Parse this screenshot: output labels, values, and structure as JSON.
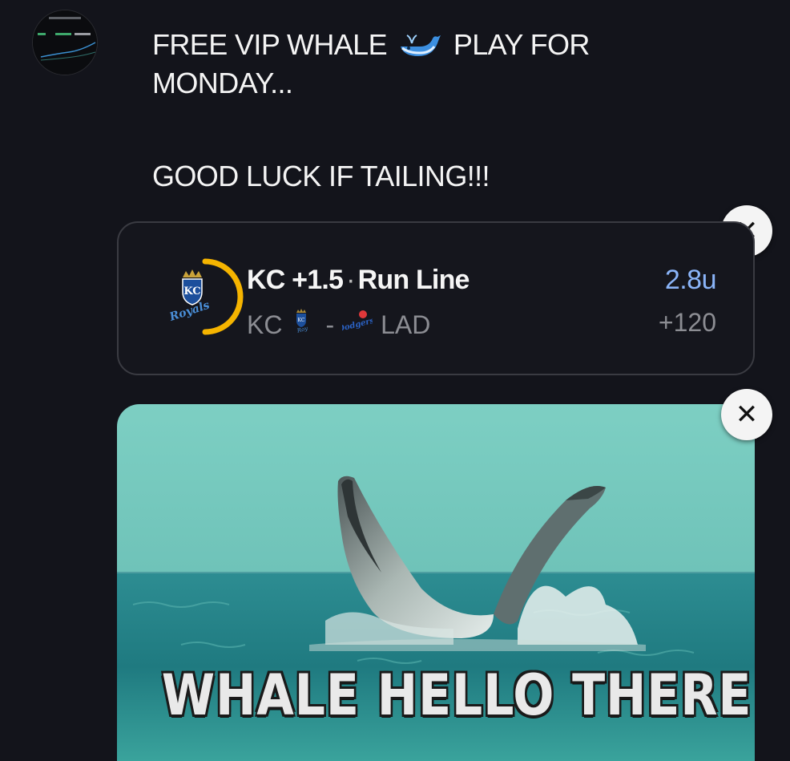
{
  "post": {
    "line1_a": "FREE VIP WHALE",
    "line1_b": "PLAY FOR",
    "line2": "MONDAY...",
    "line3": "GOOD LUCK IF TAILING!!!",
    "emoji": "whale-icon"
  },
  "bet": {
    "team": "KC",
    "line": "+1.5",
    "market": "Run Line",
    "separator": "·",
    "home": "KC",
    "dash": "-",
    "away": "LAD",
    "units": "2.8u",
    "odds": "+120"
  },
  "media": {
    "caption": "WHALE HELLO THERE"
  },
  "buttons": {
    "close": "✕"
  },
  "colors": {
    "background": "#13141b",
    "units_accent": "#8ab4f8",
    "progress_ring": "#f5b400"
  },
  "icons": {
    "avatar": "profile-avatar",
    "team_logo": "royals-logo",
    "away_logo": "dodgers-logo"
  }
}
